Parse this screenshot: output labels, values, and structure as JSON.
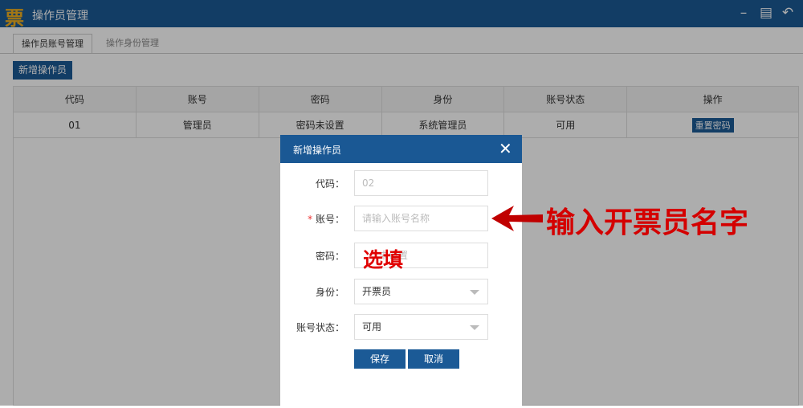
{
  "window": {
    "logo": "票",
    "title": "操作员管理"
  },
  "tabs": [
    {
      "label": "操作员账号管理",
      "active": true
    },
    {
      "label": "操作身份管理",
      "active": false
    }
  ],
  "toolbar": {
    "add_label": "新增操作员"
  },
  "table": {
    "headers": [
      "代码",
      "账号",
      "密码",
      "身份",
      "账号状态",
      "操作"
    ],
    "rows": [
      {
        "code": "01",
        "account": "管理员",
        "password": "密码未设置",
        "role": "系统管理员",
        "status": "可用",
        "action": "重置密码"
      }
    ]
  },
  "dialog": {
    "title": "新增操作员",
    "fields": {
      "code": {
        "label": "代码：",
        "value": "02"
      },
      "account": {
        "label": "账号：",
        "placeholder": "请输入账号名称",
        "required": true
      },
      "password": {
        "label": "密码：",
        "placeholder": "未设置"
      },
      "role": {
        "label": "身份：",
        "value": "开票员"
      },
      "status": {
        "label": "账号状态：",
        "value": "可用"
      }
    },
    "save_label": "保存",
    "cancel_label": "取消"
  },
  "annotations": {
    "account_hint": "输入开票员名字",
    "password_hint": "选填",
    "color": "#d40000"
  }
}
